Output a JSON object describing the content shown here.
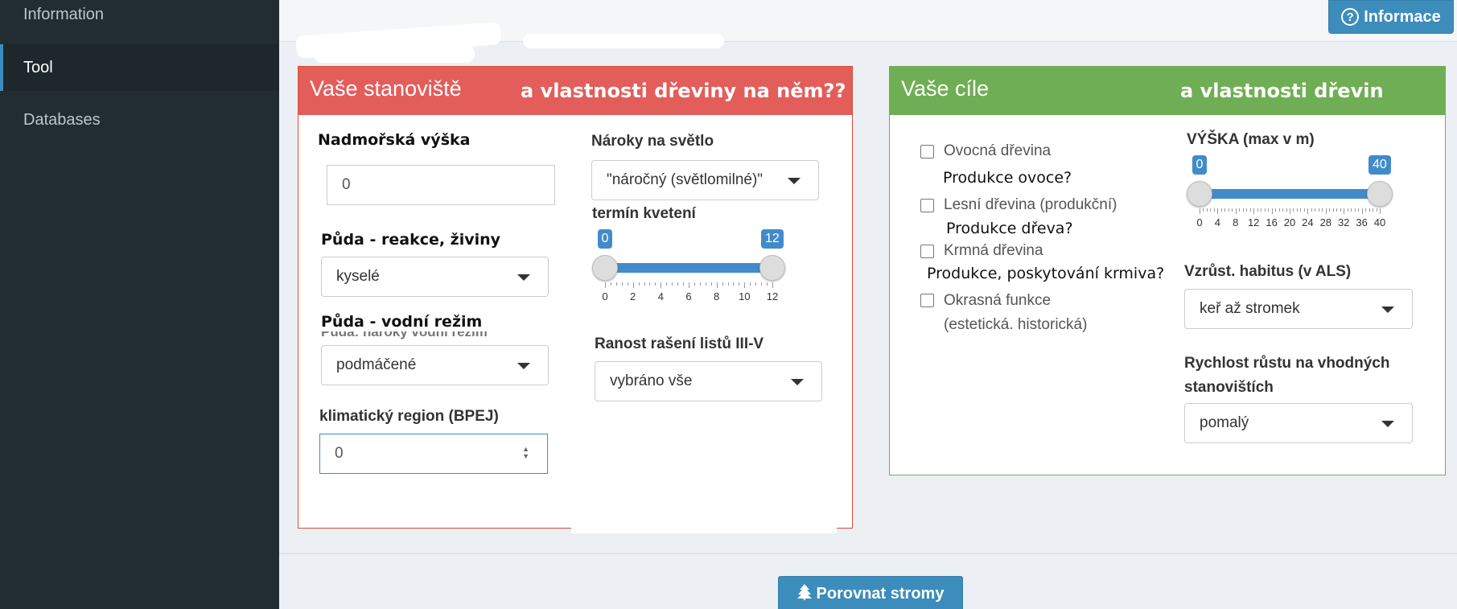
{
  "sidebar": {
    "items": [
      {
        "label": "Information"
      },
      {
        "label": "Tool"
      },
      {
        "label": "Databases"
      }
    ]
  },
  "topbar": {
    "info_button": "Informace",
    "info_icon": "question-circle-icon"
  },
  "site_box": {
    "title": "Vaše stanoviště",
    "overlay": "a vlastnosti dřeviny na něm??",
    "color": "#e35d5a",
    "altitude": {
      "label": "Nadmořská výška",
      "value": "0"
    },
    "soil_reaction": {
      "label": "Půda - reakce, živiny",
      "selected": "kyselé"
    },
    "soil_water": {
      "label": "Půda - vodní režim",
      "hidden_label": "Půda: nároky vodní režim",
      "selected": "podmáčené"
    },
    "climate_region": {
      "label": "klimatický region (BPEJ)",
      "value": "0"
    },
    "light": {
      "label": "Nároky na světlo",
      "selected": "\"náročný (světlomilné)\""
    },
    "flowering": {
      "label": "termín kvetení",
      "min": 0,
      "max": 12,
      "from": 0,
      "to": 12,
      "ticks": [
        "0",
        "2",
        "4",
        "6",
        "8",
        "10",
        "12"
      ],
      "from_label": "0",
      "to_label": "12"
    },
    "leafing": {
      "label": "Ranost rašení listů III-V",
      "selected": "vybráno vše"
    }
  },
  "goals_box": {
    "title": "Vaše cíle",
    "overlay": "a vlastnosti dřevin",
    "color": "#6fae54",
    "checkboxes": [
      {
        "label": "Ovocná dřevina",
        "checked": false
      },
      {
        "label": "Lesní dřevina (produkční)",
        "checked": false
      },
      {
        "label": "Krmná dřevina",
        "checked": false
      },
      {
        "label": "Okrasná funkce (estetická. historická)",
        "checked": false
      }
    ],
    "annotations": [
      "Produkce ovoce?",
      "Produkce dřeva?",
      "Produkce, poskytování krmiva?"
    ],
    "height": {
      "label": "VÝŠKA (max v m)",
      "min": 0,
      "max": 40,
      "from": 0,
      "to": 40,
      "ticks": [
        "0",
        "4",
        "8",
        "12",
        "16",
        "20",
        "24",
        "28",
        "32",
        "36",
        "40"
      ],
      "from_label": "0",
      "to_label": "40"
    },
    "habitus": {
      "label": "Vzrůst. habitus (v ALS)",
      "selected": "keř až stromek"
    },
    "growth_rate": {
      "label": "Rychlost růstu na vhodných stanovištích",
      "selected": "pomalý"
    }
  },
  "footer": {
    "compare_button": "Porovnat stromy",
    "compare_icon": "tree-icon"
  }
}
